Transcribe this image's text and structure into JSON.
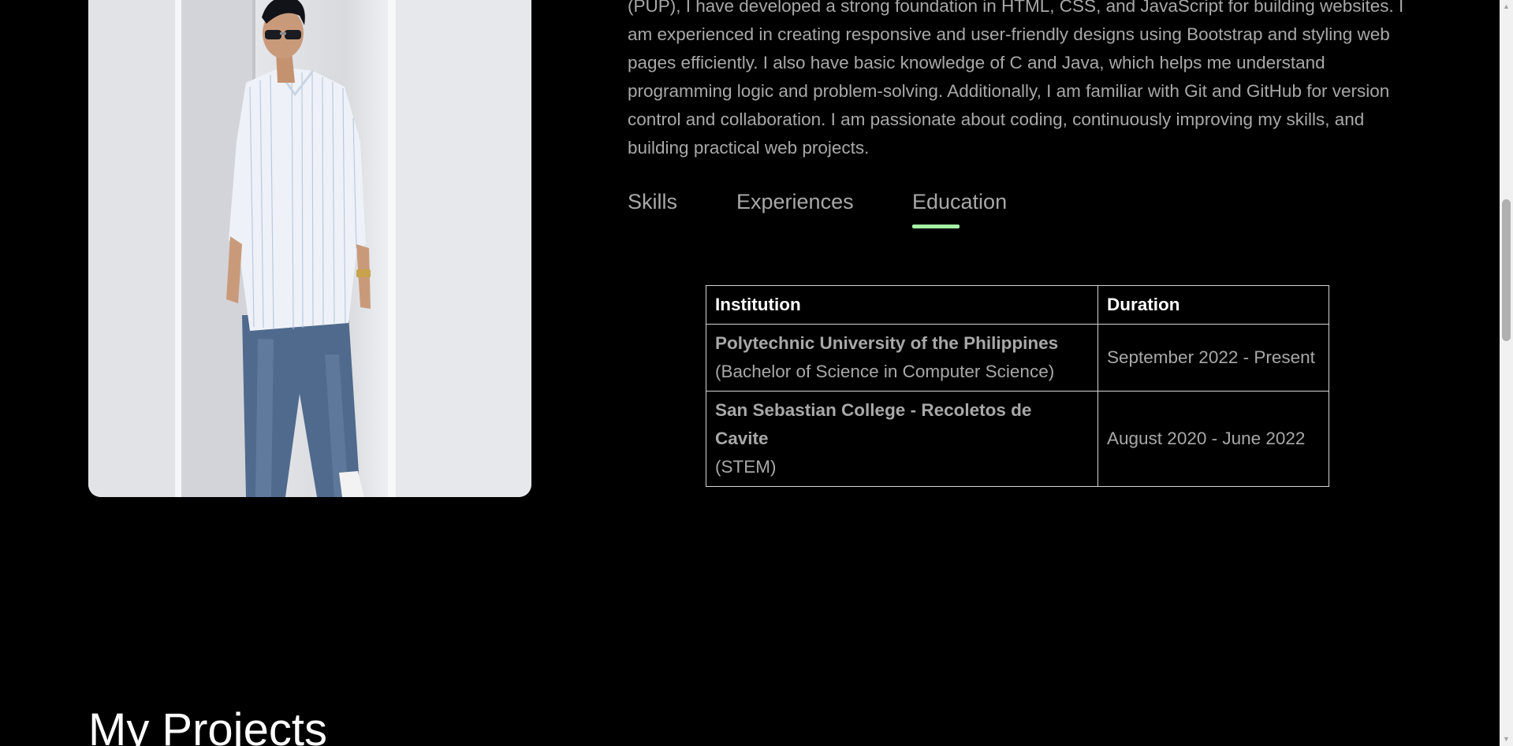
{
  "about": {
    "paragraph": "(PUP), I have developed a strong foundation in HTML, CSS, and JavaScript for building websites. I am experienced in creating responsive and user-friendly designs using Bootstrap and styling web pages efficiently. I also have basic knowledge of C and Java, which helps me understand programming logic and problem-solving. Additionally, I am familiar with Git and GitHub for version control and collaboration. I am passionate about coding, continuously improving my skills, and building practical web projects."
  },
  "tabs": [
    {
      "label": "Skills",
      "active": false
    },
    {
      "label": "Experiences",
      "active": false
    },
    {
      "label": "Education",
      "active": true
    }
  ],
  "education_table": {
    "headers": [
      "Institution",
      "Duration"
    ],
    "rows": [
      {
        "institution": "Polytechnic University of the Philippines",
        "program": "(Bachelor of Science in Computer Science)",
        "duration": "September 2022 - Present"
      },
      {
        "institution": "San Sebastian College - Recoletos de Cavite",
        "program": "(STEM)",
        "duration": "August 2020 - June 2022"
      }
    ]
  },
  "projects": {
    "heading": "My Projects"
  },
  "colors": {
    "background": "#000000",
    "body_text": "#a8a8a8",
    "heading_text": "#ffffff",
    "accent": "#a5f0a6",
    "table_border": "#d6d6d6"
  },
  "icons": {
    "scroll_up": "scroll-up-arrow-icon",
    "scroll_down": "scroll-down-arrow-icon"
  }
}
